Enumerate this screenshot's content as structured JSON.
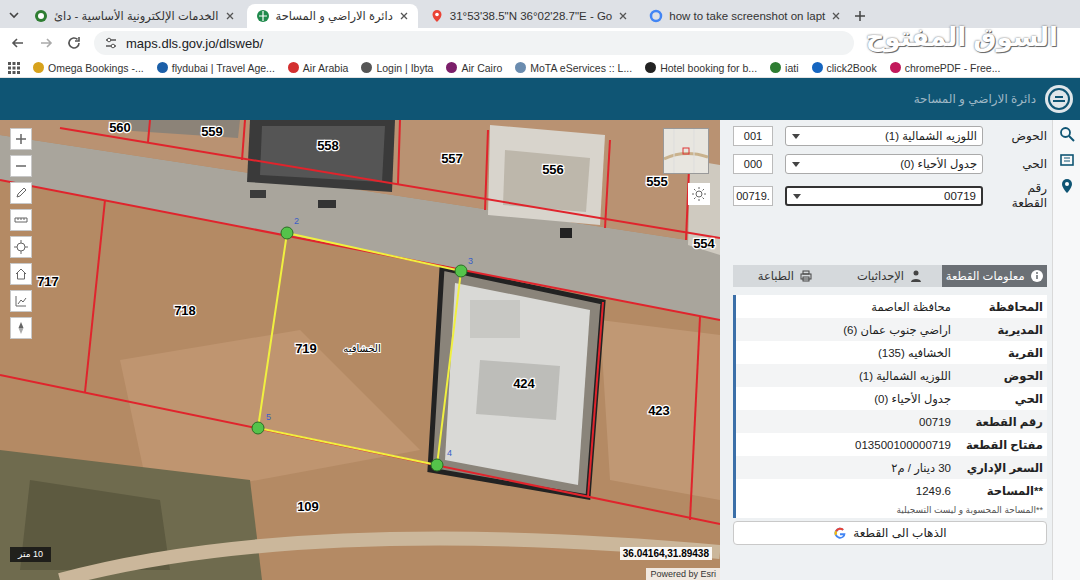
{
  "browser": {
    "tabs": [
      {
        "label": "الخدمات الإلكترونية الأساسية - دائ",
        "selected": false
      },
      {
        "label": "دائرة الاراضي و المساحة",
        "selected": true
      },
      {
        "label": "31°53'38.5\"N 36°02'28.7\"E - Go",
        "selected": false
      },
      {
        "label": "how to take screenshot on lapt",
        "selected": false
      }
    ],
    "address": "maps.dls.gov.jo/dlsweb/",
    "bookmarks": [
      {
        "label": "Omega Bookings -...",
        "color": "#d7a21c"
      },
      {
        "label": "flydubai | Travel Age...",
        "color": "#1b5fa8"
      },
      {
        "label": "Air Arabia",
        "color": "#d32f2f"
      },
      {
        "label": "Login | Ibyta",
        "color": "#555555"
      },
      {
        "label": "Air Cairo",
        "color": "#7b1f6a"
      },
      {
        "label": "MoTA eServices :: L...",
        "color": "#6a8caf"
      },
      {
        "label": "Hotel booking for b...",
        "color": "#222222"
      },
      {
        "label": "iati",
        "color": "#2e7d32"
      },
      {
        "label": "click2Book",
        "color": "#1565c0"
      },
      {
        "label": "chromePDF - Free...",
        "color": "#c2185b"
      }
    ]
  },
  "watermark": "السوق المفتوح",
  "app": {
    "title": "دائرة الاراضي و المساحة"
  },
  "map": {
    "parcels": [
      {
        "label": "560"
      },
      {
        "label": "559"
      },
      {
        "label": "558"
      },
      {
        "label": "557"
      },
      {
        "label": "556"
      },
      {
        "label": "555"
      },
      {
        "label": "554"
      },
      {
        "label": "717"
      },
      {
        "label": "718"
      },
      {
        "label": "719"
      },
      {
        "label": "424"
      },
      {
        "label": "423"
      },
      {
        "label": "109"
      }
    ],
    "place_label": "الخشافيه",
    "vertices": [
      {
        "label": "2"
      },
      {
        "label": "3"
      },
      {
        "label": "4"
      },
      {
        "label": "5"
      }
    ],
    "scale": "10 متر",
    "coordinates": "36.04164,31.89438",
    "attribution": "Powered by Esri"
  },
  "search": {
    "fields": [
      {
        "label": "الحوض",
        "code": "001",
        "value": "اللوزيه الشمالية (1)",
        "focused": false
      },
      {
        "label": "الحي",
        "code": "000",
        "value": "جدول الأحياء (0)",
        "focused": false
      },
      {
        "label": "رقم القطعة",
        "code": "00719.",
        "value": "00719",
        "focused": true
      }
    ]
  },
  "panel_tabs": [
    {
      "label": "الطباعة",
      "selected": false
    },
    {
      "label": "الإحداثيات",
      "selected": false
    },
    {
      "label": "معلومات القطعة",
      "selected": true
    }
  ],
  "info": {
    "rows": [
      {
        "label": "المحافظة",
        "value": "محافظة العاصمة"
      },
      {
        "label": "المديرية",
        "value": "اراضي جنوب عمان (6)"
      },
      {
        "label": "القرية",
        "value": "الخشافيه (135)"
      },
      {
        "label": "الحوض",
        "value": "اللوزيه الشمالية (1)"
      },
      {
        "label": "الحي",
        "value": "جدول الأحياء (0)"
      },
      {
        "label": "رقم القطعة",
        "value": "00719"
      },
      {
        "label": "مفتاح القطعة",
        "value": "013500100000719"
      },
      {
        "label": "السعر الإداري",
        "value": "30 دينار / م٢"
      },
      {
        "label": "**المساحة",
        "value": "1249.6"
      }
    ],
    "note": "**المساحة المحسوبة و ليست التسجيلية",
    "button": "الذهاب الى القطعة"
  }
}
